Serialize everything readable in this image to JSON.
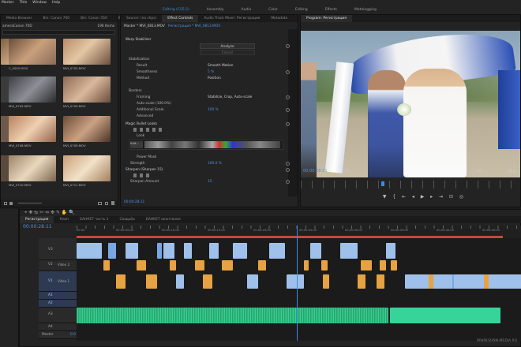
{
  "menu": [
    "Marker",
    "Title",
    "Window",
    "Help"
  ],
  "workspaces": [
    "Editing (CS5.5)",
    "Assembly",
    "Audio",
    "Color",
    "Editing",
    "Effects",
    "Metalogging"
  ],
  "project": {
    "tabs": [
      "Media Browser",
      "Bin: Canon 700",
      "Bin: Canon 550",
      "Bin: Canon 550D"
    ],
    "path": "ameraCanon 70D",
    "count": "196 Items",
    "items": [
      {
        "label": "C_0002.MOV",
        "meta": "0:00:19"
      },
      {
        "label": "MVI_0705.MOV",
        "meta": ""
      },
      {
        "label": "MVI_0745.MOV",
        "meta": "0:12:10"
      },
      {
        "label": "MVI_0709.MOV",
        "meta": ""
      },
      {
        "label": "MVI_0708.MOV",
        "meta": ""
      },
      {
        "label": "MVI_0709.MOV",
        "meta": ""
      },
      {
        "label": "MVI_0710.MOV",
        "meta": ""
      },
      {
        "label": "MVI_0711.MOV",
        "meta": ""
      }
    ]
  },
  "effects": {
    "tabs": [
      "Source: (no clips)",
      "Effect Controls",
      "Audio Track Mixer: Регистрация",
      "Metadata"
    ],
    "header": "Master * MVI_0813.MOV",
    "seq": "Регистрация * MVI_0813.MOV",
    "warp": "Warp Stabilizer",
    "analyze": "Analyze",
    "cancel": "Cancel",
    "stab_label": "Stabilization",
    "result_label": "Result",
    "result_val": "Smooth Motion",
    "smooth_label": "Smoothness",
    "smooth_val": "5 %",
    "method_label": "Method",
    "method_val": "Position",
    "borders_label": "Borders",
    "framing_label": "Framing",
    "framing_val": "Stabilize, Crop, Auto-scale",
    "autoscale_label": "Auto-scale (100.0%)",
    "addscale_label": "Additional Scale",
    "addscale_val": "100 %",
    "advanced_label": "Advanced",
    "lumetri": "Magic Bullet Looks",
    "look_label": "Look",
    "edit_label": "Edit...",
    "power_label": "Power Mask",
    "strength_label": "Strength",
    "strength_val": "100.0 %",
    "sharpen_label": "Sharpen (Sharpen 15)",
    "sharpen_amount_label": "Sharpen Amount",
    "sharpen_amount_val": "15",
    "timecode": "00:00:28:11"
  },
  "program": {
    "tab": "Program: Регистрация",
    "timecode": "00:00:28:11",
    "fit": "Fit",
    "fraction": "1/2",
    "duration": "00:0"
  },
  "timeline": {
    "tabs": [
      "Регистрация",
      "Клип",
      "БАНКЕТ часть 1",
      "Свадьба",
      "БАНКЕТ окончания"
    ],
    "timecode": "00:00:28:11",
    "ruler": [
      "00:00",
      "00:00:05:00",
      "00:00:10:00",
      "00:00:15:00",
      "00:00:20:00",
      "00:00:25:00",
      "00:00:30:00",
      "00:00:35:00",
      "00:00:40:00",
      "00:00:45:00"
    ],
    "tracks": [
      {
        "id": "V3",
        "name": ""
      },
      {
        "id": "V2",
        "name": "Video 2"
      },
      {
        "id": "V1",
        "name": ""
      },
      {
        "id": "V1",
        "name": "Video 1"
      },
      {
        "id": "A1",
        "name": ""
      },
      {
        "id": "A2",
        "name": ""
      },
      {
        "id": "A3",
        "name": ""
      },
      {
        "id": "A4",
        "name": ""
      },
      {
        "id": "Master",
        "name": "0.0"
      }
    ]
  },
  "watermark": "WWW.SUNN-MEDIA.RU"
}
